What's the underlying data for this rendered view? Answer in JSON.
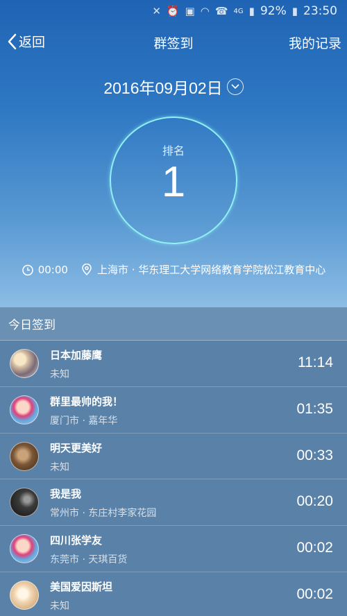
{
  "status": {
    "battery": "92%",
    "time": "23:50",
    "network": "4G"
  },
  "nav": {
    "back": "返回",
    "title": "群签到",
    "right": "我的记录"
  },
  "date": "2016年09月02日",
  "rank": {
    "label": "排名",
    "value": "1"
  },
  "meta": {
    "time": "00:00",
    "location": "上海市 · 华东理工大学网络教育学院松江教育中心"
  },
  "panel": {
    "title": "今日签到"
  },
  "rows": [
    {
      "name": "日本加藤鹰",
      "location": "未知",
      "time": "11:14"
    },
    {
      "name": "群里最帅的我！",
      "location": "厦门市 · 嘉年华",
      "time": "01:35"
    },
    {
      "name": "明天更美好",
      "location": "未知",
      "time": "00:33"
    },
    {
      "name": "我是我",
      "location": "常州市 · 东庄村李家花园",
      "time": "00:20"
    },
    {
      "name": "四川张学友",
      "location": "东莞市 · 天琪百货",
      "time": "00:02"
    },
    {
      "name": "美国爱因斯坦",
      "location": "未知",
      "time": "00:02"
    }
  ],
  "colors": {
    "accent_ring": "#8ff1f3",
    "panel_bg": "#5a82a8",
    "header_bg": "#6a90b3"
  }
}
